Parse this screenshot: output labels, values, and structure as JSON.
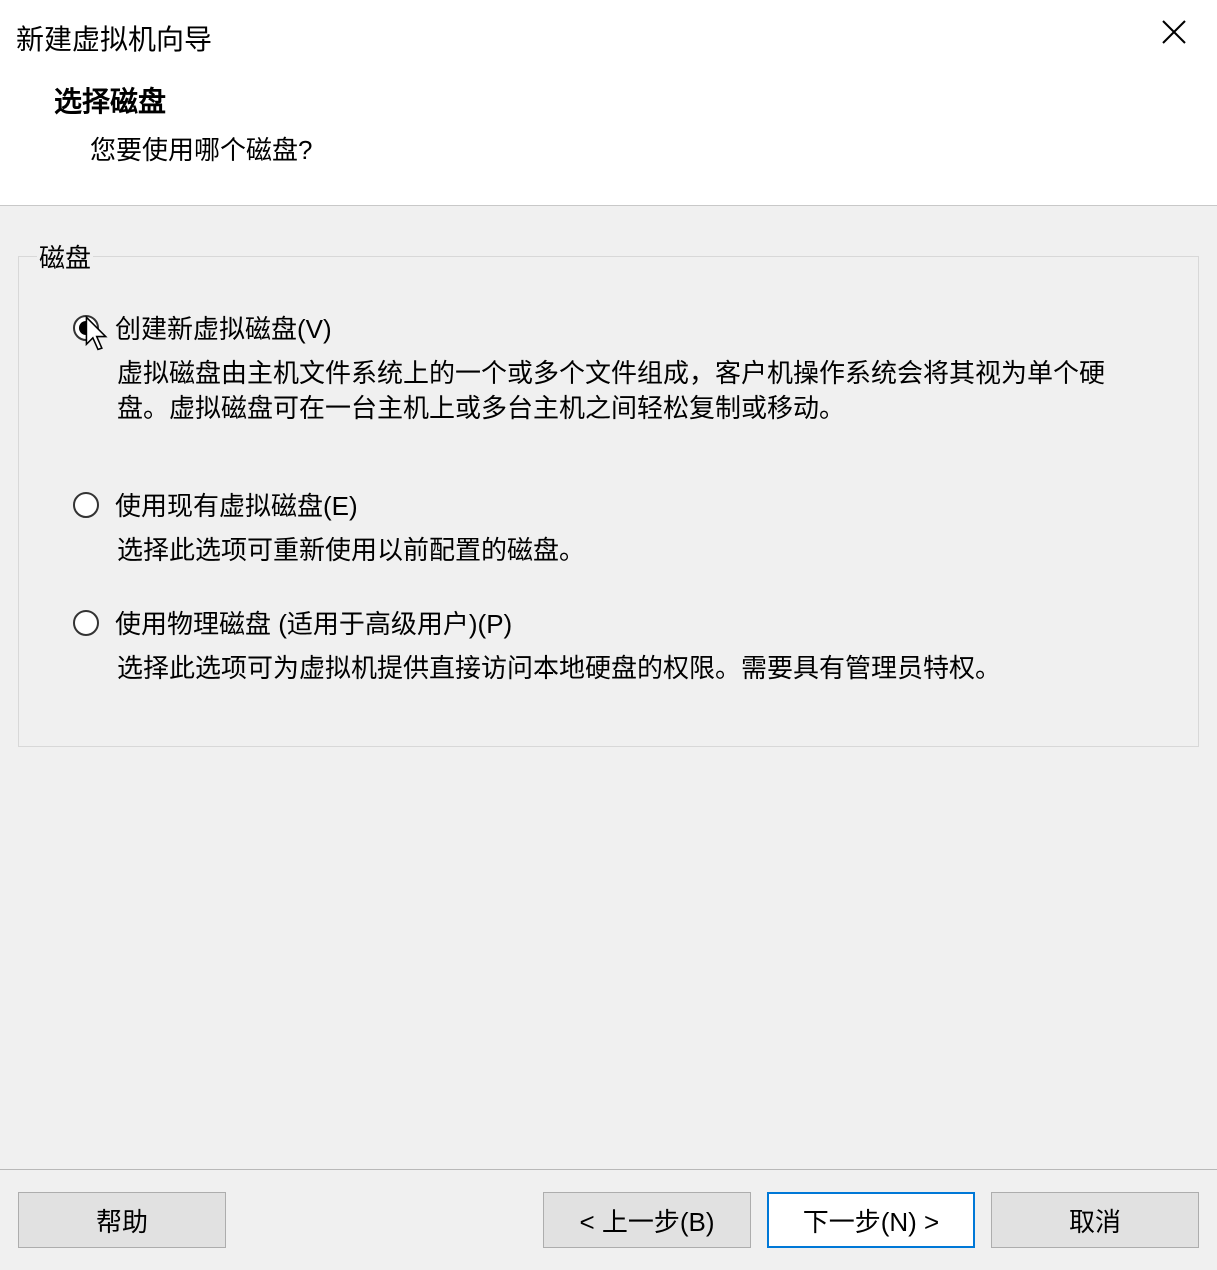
{
  "window": {
    "title": "新建虚拟机向导"
  },
  "header": {
    "heading": "选择磁盘",
    "subheading": "您要使用哪个磁盘?"
  },
  "group": {
    "legend": "磁盘"
  },
  "options": [
    {
      "label": "创建新虚拟磁盘(V)",
      "desc": "虚拟磁盘由主机文件系统上的一个或多个文件组成，客户机操作系统会将其视为单个硬盘。虚拟磁盘可在一台主机上或多台主机之间轻松复制或移动。",
      "selected": true
    },
    {
      "label": "使用现有虚拟磁盘(E)",
      "desc": "选择此选项可重新使用以前配置的磁盘。",
      "selected": false
    },
    {
      "label": "使用物理磁盘 (适用于高级用户)(P)",
      "desc": "选择此选项可为虚拟机提供直接访问本地硬盘的权限。需要具有管理员特权。",
      "selected": false
    }
  ],
  "footer": {
    "help": "帮助",
    "back": "< 上一步(B)",
    "next": "下一步(N) >",
    "cancel": "取消"
  }
}
